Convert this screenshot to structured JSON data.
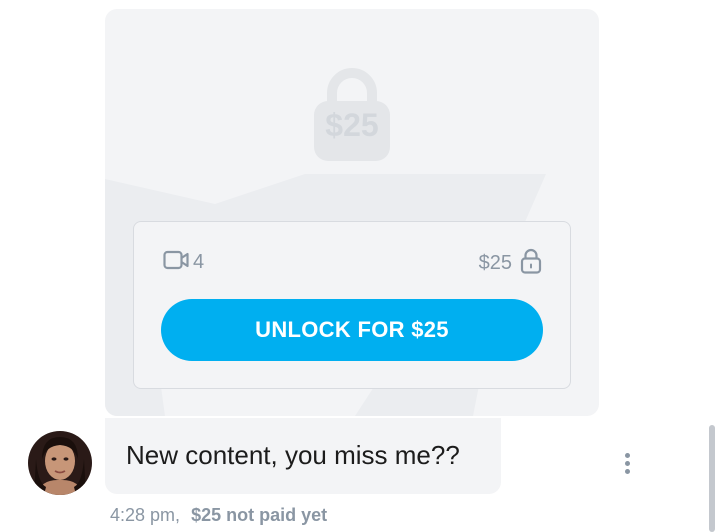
{
  "locked_post": {
    "big_lock_price": "$25",
    "media": {
      "icon": "video-camera-icon",
      "count": "4"
    },
    "price": "$25",
    "price_icon": "lock-icon",
    "unlock_button_label": "UNLOCK FOR $25"
  },
  "message": {
    "text": "New content, you miss me??",
    "time": "4:28 pm,",
    "status": "$25 not paid yet"
  },
  "colors": {
    "accent": "#00aff0",
    "muted": "#8a96a3",
    "card_bg": "#f3f4f6"
  }
}
